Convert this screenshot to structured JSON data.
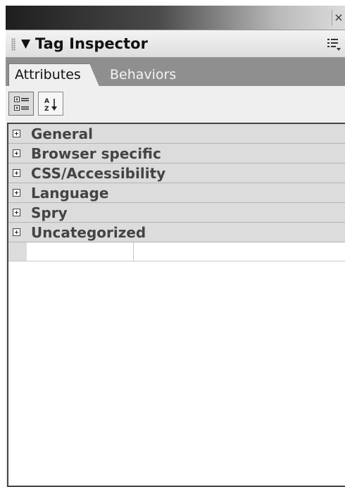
{
  "window": {
    "close_glyph": "×"
  },
  "panel": {
    "title": "Tag Inspector",
    "collapse_glyph": "▼"
  },
  "tabs": [
    {
      "label": "Attributes",
      "active": true
    },
    {
      "label": "Behaviors",
      "active": false
    }
  ],
  "toolbar": {
    "buttons": [
      {
        "icon": "category-view-icon",
        "pressed": true
      },
      {
        "icon": "sort-alphabetical-icon",
        "pressed": false
      }
    ]
  },
  "categories": [
    {
      "label": "General"
    },
    {
      "label": "Browser specific"
    },
    {
      "label": "CSS/Accessibility"
    },
    {
      "label": "Language"
    },
    {
      "label": "Spry"
    },
    {
      "label": "Uncategorized"
    }
  ],
  "colors": {
    "category_bg": "#dcdcdc",
    "tab_strip": "#8f8f8f",
    "list_bg": "#ffffff"
  }
}
